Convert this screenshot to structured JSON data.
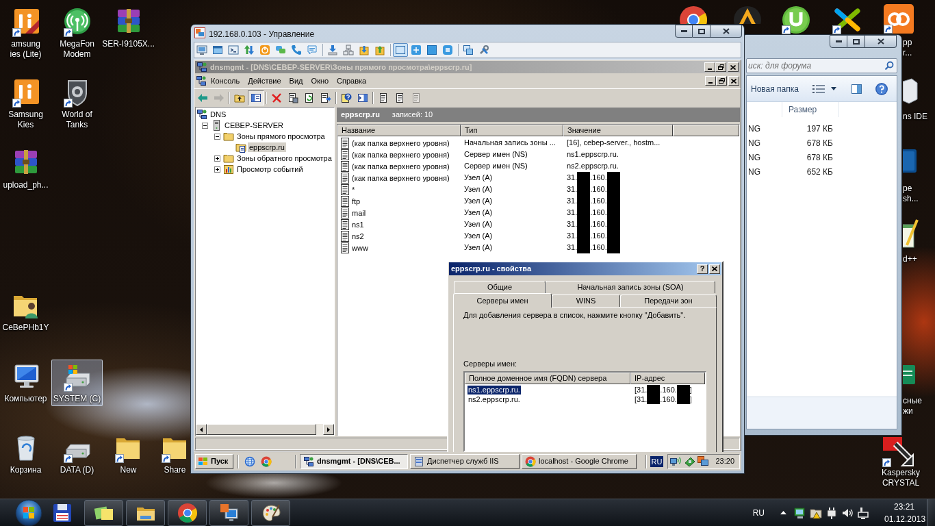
{
  "desktop": {
    "icons": [
      {
        "kind": "kieslite",
        "label_lines": [
          "amsung",
          "ies (Lite)"
        ],
        "shortcut": true,
        "selected": false
      },
      {
        "kind": "modem",
        "label_lines": [
          "MegaFon",
          "Modem"
        ],
        "shortcut": true,
        "selected": false
      },
      {
        "kind": "archive",
        "label_lines": [
          "SER-I9105X..."
        ],
        "shortcut": false,
        "selected": false
      },
      {
        "kind": "kies",
        "label_lines": [
          "Samsung",
          "Kies"
        ],
        "shortcut": true,
        "selected": false
      },
      {
        "kind": "tanks",
        "label_lines": [
          "World of",
          "Tanks"
        ],
        "shortcut": true,
        "selected": false
      },
      {
        "kind": "archive",
        "label_lines": [
          "upload_ph..."
        ],
        "shortcut": false,
        "selected": false
      },
      {
        "kind": "userfolder",
        "label_lines": [
          "CeBePHb1Y"
        ],
        "shortcut": false,
        "selected": false
      },
      {
        "kind": "computer",
        "label_lines": [
          "Компьютер"
        ],
        "shortcut": false,
        "selected": false
      },
      {
        "kind": "systemdrive",
        "label_lines": [
          "SYSTEM (C)"
        ],
        "shortcut": true,
        "selected": true
      },
      {
        "kind": "trash",
        "label_lines": [
          "Корзина"
        ],
        "shortcut": false,
        "selected": false
      },
      {
        "kind": "drive",
        "label_lines": [
          "DATA (D)"
        ],
        "shortcut": true,
        "selected": false
      },
      {
        "kind": "folder",
        "label_lines": [
          "New"
        ],
        "shortcut": true,
        "selected": false
      },
      {
        "kind": "folder",
        "label_lines": [
          "Share"
        ],
        "shortcut": true,
        "selected": false
      }
    ],
    "edge_icons": [
      {
        "kind": "chrome",
        "shortcut": false,
        "selected": false
      },
      {
        "kind": "aimp",
        "shortcut": false,
        "selected": false
      },
      {
        "kind": "utorrent",
        "shortcut": true,
        "selected": false
      },
      {
        "kind": "studio",
        "shortcut": true,
        "selected": false
      },
      {
        "kind": "xampp",
        "label_lines": [
          "pp",
          "r..."
        ],
        "shortcut": true,
        "selected": false
      },
      {
        "kind": "netbeans",
        "label_lines": [
          "ns IDE"
        ],
        "shortcut": false,
        "selected": false
      },
      {
        "kind": "photoshop",
        "label_lines": [
          "pe",
          "sh..."
        ],
        "shortcut": false,
        "selected": false
      },
      {
        "kind": "notepad",
        "label_lines": [
          "d++"
        ],
        "shortcut": false,
        "selected": false
      },
      {
        "kind": "sheet",
        "label_lines": [
          "сные",
          "жи"
        ],
        "shortcut": false,
        "selected": false
      },
      {
        "kind": "kaspersky",
        "label_lines": [
          "Kaspersky",
          "CRYSTAL"
        ],
        "shortcut": true,
        "selected": false
      }
    ]
  },
  "explorer_window": {
    "search": {
      "placeholder": "иск: для форума"
    },
    "toolbar": {
      "new_folder": "Новая папка"
    },
    "columns": [
      "Размер"
    ],
    "rows": [
      {
        "column_1": "NG",
        "size": "197 КБ"
      },
      {
        "column_1": "NG",
        "size": "678 КБ"
      },
      {
        "column_1": "NG",
        "size": "678 КБ"
      },
      {
        "column_1": "NG",
        "size": "652 КБ"
      }
    ]
  },
  "remote_window": {
    "title": "192.168.0.103 - Управление",
    "toolbar_groups": [
      [
        {
          "pressed": false
        },
        {
          "pressed": false
        },
        {
          "pressed": false
        },
        {
          "pressed": false
        },
        {
          "pressed": false
        },
        {
          "pressed": false
        },
        {
          "pressed": false
        },
        {
          "pressed": false
        }
      ],
      [
        {
          "pressed": false
        },
        {
          "pressed": false
        },
        {
          "pressed": false
        },
        {
          "pressed": false
        }
      ],
      [
        {
          "pressed": true
        },
        {
          "pressed": false
        },
        {
          "pressed": false
        },
        {
          "pressed": false
        }
      ],
      [
        {
          "pressed": false
        },
        {
          "pressed": false
        }
      ]
    ],
    "mmc": {
      "title": "dnsmgmt - [DNS\\СЕВЕР-SERVER\\Зоны прямого просмотра\\eppscrp.ru]",
      "active": false,
      "menu": [
        "Консоль",
        "Действие",
        "Вид",
        "Окно",
        "Справка"
      ],
      "toolbar_groups": [
        [
          {
            "pressed": false,
            "disabled": false
          },
          {
            "pressed": false,
            "disabled": true
          }
        ],
        [
          {
            "pressed": false,
            "disabled": false
          },
          {
            "pressed": true,
            "disabled": false
          }
        ],
        [
          {
            "pressed": false,
            "disabled": false
          },
          {
            "pressed": false,
            "disabled": false
          },
          {
            "pressed": false,
            "disabled": false
          },
          {
            "pressed": false,
            "disabled": false
          }
        ],
        [
          {
            "pressed": false,
            "disabled": false
          },
          {
            "pressed": false,
            "disabled": false
          }
        ],
        [
          {
            "pressed": false,
            "disabled": false
          },
          {
            "pressed": false,
            "disabled": false
          },
          {
            "pressed": false,
            "disabled": true
          }
        ]
      ],
      "tree": [
        {
          "kind": "dns",
          "label": "DNS",
          "selected": false,
          "children": [
            {
              "kind": "server",
              "label": "СЕВЕР-SERVER",
              "expanded": true,
              "selected": false,
              "children": [
                {
                  "kind": "folder",
                  "label": "Зоны прямого просмотра",
                  "expanded": true,
                  "selected": false,
                  "children": [
                    {
                      "kind": "zone",
                      "label": "eppscrp.ru",
                      "selected": true
                    }
                  ]
                },
                {
                  "kind": "folder",
                  "label": "Зоны обратного просмотра",
                  "expanded": false,
                  "selected": false
                },
                {
                  "kind": "events",
                  "label": "Просмотр событий",
                  "expanded": false,
                  "selected": false
                }
              ]
            }
          ]
        }
      ],
      "list": {
        "title": "eppscrp.ru",
        "count": "записей: 10",
        "columns": [
          "Название",
          "Тип",
          "Значение"
        ],
        "rows": [
          {
            "name": "(как папка верхнего уровня)",
            "type": "Начальная запись зоны ...",
            "value": [
              {
                "kind": "text",
                "text": "[16], cebep-server., hostm..."
              }
            ],
            "selected": false
          },
          {
            "name": "(как папка верхнего уровня)",
            "type": "Сервер имен (NS)",
            "value": [
              {
                "kind": "text",
                "text": "ns1.eppscrp.ru."
              }
            ],
            "selected": false
          },
          {
            "name": "(как папка верхнего уровня)",
            "type": "Сервер имен (NS)",
            "value": [
              {
                "kind": "text",
                "text": "ns2.eppscrp.ru."
              }
            ],
            "selected": false
          },
          {
            "name": "(как папка верхнего уровня)",
            "type": "Узел (A)",
            "value": [
              {
                "kind": "text",
                "text": "31."
              },
              {
                "kind": "redaction"
              },
              {
                "kind": "text",
                "text": ".160."
              },
              {
                "kind": "redaction"
              }
            ],
            "selected": false
          },
          {
            "name": "*",
            "type": "Узел (A)",
            "value": [
              {
                "kind": "text",
                "text": "31."
              },
              {
                "kind": "redaction"
              },
              {
                "kind": "text",
                "text": ".160."
              },
              {
                "kind": "redaction"
              }
            ],
            "selected": false
          },
          {
            "name": "ftp",
            "type": "Узел (A)",
            "value": [
              {
                "kind": "text",
                "text": "31."
              },
              {
                "kind": "redaction"
              },
              {
                "kind": "text",
                "text": ".160."
              },
              {
                "kind": "redaction"
              }
            ],
            "selected": false
          },
          {
            "name": "mail",
            "type": "Узел (A)",
            "value": [
              {
                "kind": "text",
                "text": "31."
              },
              {
                "kind": "redaction"
              },
              {
                "kind": "text",
                "text": ".160."
              },
              {
                "kind": "redaction"
              }
            ],
            "selected": false
          },
          {
            "name": "ns1",
            "type": "Узел (A)",
            "value": [
              {
                "kind": "text",
                "text": "31."
              },
              {
                "kind": "redaction"
              },
              {
                "kind": "text",
                "text": ".160."
              },
              {
                "kind": "redaction"
              }
            ],
            "selected": false
          },
          {
            "name": "ns2",
            "type": "Узел (A)",
            "value": [
              {
                "kind": "text",
                "text": "31."
              },
              {
                "kind": "redaction"
              },
              {
                "kind": "text",
                "text": ".160."
              },
              {
                "kind": "redaction"
              }
            ],
            "selected": false
          },
          {
            "name": "www",
            "type": "Узел (A)",
            "value": [
              {
                "kind": "text",
                "text": "31."
              },
              {
                "kind": "redaction"
              },
              {
                "kind": "text",
                "text": ".160."
              },
              {
                "kind": "redaction"
              }
            ],
            "selected": false
          }
        ]
      }
    },
    "dialog": {
      "title": "eppscrp.ru - свойства",
      "active": true,
      "help_button": "?",
      "tab_rows": [
        [
          {
            "label": "Общие",
            "selected": false
          },
          {
            "label": "Начальная запись зоны (SOA)",
            "selected": false
          }
        ],
        [
          {
            "label": "Серверы имен",
            "selected": true
          },
          {
            "label": "WINS",
            "selected": false
          },
          {
            "label": "Передачи зон",
            "selected": false
          }
        ]
      ],
      "hint": "Для добавления сервера в список, нажмите кнопку \"Добавить\".",
      "list_label": "Серверы имен:",
      "columns": [
        "Полное доменное имя (FQDN) сервера",
        "IP-адрес"
      ],
      "rows": [
        {
          "fqdn": "ns1.eppscrp.ru.",
          "ip": [
            {
              "kind": "text",
              "text": "[31."
            },
            {
              "kind": "redaction"
            },
            {
              "kind": "text",
              "text": ".160."
            },
            {
              "kind": "redaction"
            },
            {
              "kind": "text",
              "text": "]"
            }
          ],
          "selected": true
        },
        {
          "fqdn": "ns2.eppscrp.ru.",
          "ip": [
            {
              "kind": "text",
              "text": "[31."
            },
            {
              "kind": "redaction"
            },
            {
              "kind": "text",
              "text": ".160."
            },
            {
              "kind": "redaction"
            },
            {
              "kind": "text",
              "text": "]"
            }
          ],
          "selected": false
        }
      ]
    },
    "remote_taskbar": {
      "start": "Пуск",
      "tasks": [
        {
          "label": "dnsmgmt - [DNS\\СЕВ...",
          "selected": true
        },
        {
          "label": "Диспетчер служб IIS",
          "selected": false
        },
        {
          "label": "localhost - Google Chrome",
          "selected": false
        }
      ],
      "language": "RU",
      "clock": "23:20"
    }
  },
  "taskbar": {
    "pinned": [
      {
        "running": false
      },
      {
        "running": true
      },
      {
        "running": true
      },
      {
        "running": true
      },
      {
        "running": true
      },
      {
        "running": true
      }
    ],
    "language": "RU",
    "clock": {
      "time": "23:21",
      "date": "01.12.2013"
    }
  }
}
